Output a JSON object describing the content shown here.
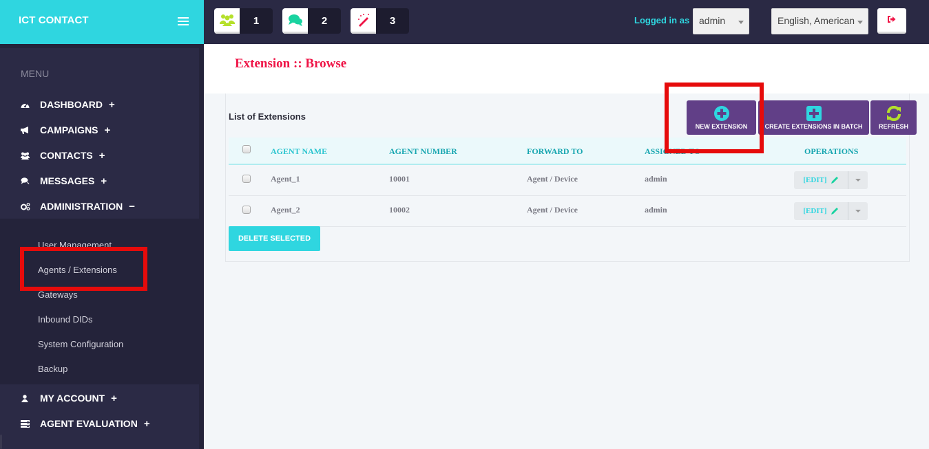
{
  "app": {
    "title": "ICT CONTACT",
    "menu_toggle_icon": "hamburger-icon"
  },
  "header": {
    "notifications": [
      {
        "icon": "users-icon",
        "count": "1",
        "color": "#b5e02b"
      },
      {
        "icon": "chat-bubbles-icon",
        "count": "2",
        "color": "#19d3a0"
      },
      {
        "icon": "magic-wand-icon",
        "count": "3",
        "color": "#ef1547"
      }
    ],
    "logged_in_label": "Logged in as :",
    "user_select_value": "admin",
    "language_select_value": "English, American",
    "logout_icon": "sign-out-icon"
  },
  "sidebar": {
    "menu_label": "MENU",
    "items": [
      {
        "label": "DASHBOARD",
        "icon": "dashboard-icon",
        "toggle": "+"
      },
      {
        "label": "CAMPAIGNS",
        "icon": "bullhorn-icon",
        "toggle": "+"
      },
      {
        "label": "CONTACTS",
        "icon": "users-icon",
        "toggle": "+"
      },
      {
        "label": "MESSAGES",
        "icon": "comments-icon",
        "toggle": "+"
      },
      {
        "label": "ADMINISTRATION",
        "icon": "cogs-icon",
        "toggle": "−"
      },
      {
        "label": "MY ACCOUNT",
        "icon": "user-icon",
        "toggle": "+"
      },
      {
        "label": "AGENT EVALUATION",
        "icon": "tasks-icon",
        "toggle": "+"
      }
    ],
    "admin_subitems": [
      "User Management",
      "Agents / Extensions",
      "Gateways",
      "Inbound DIDs",
      "System Configuration",
      "Backup"
    ],
    "active_subitem": "Agents / Extensions"
  },
  "page": {
    "title": "Extension :: Browse",
    "list_title": "List of Extensions",
    "actions": [
      {
        "label": "NEW EXTENSION",
        "icon": "plus-circle-icon"
      },
      {
        "label": "CREATE EXTENSIONS IN BATCH",
        "icon": "plus-square-icon"
      },
      {
        "label": "REFRESH",
        "icon": "refresh-icon"
      }
    ],
    "table": {
      "columns": [
        "AGENT NAME",
        "AGENT NUMBER",
        "FORWARD TO",
        "ASSIGNED TO",
        "OPERATIONS"
      ],
      "rows": [
        {
          "agent_name": "Agent_1",
          "agent_number": "10001",
          "forward_to": "Agent / Device",
          "assigned_to": "admin",
          "operation": "[EDIT]"
        },
        {
          "agent_name": "Agent_2",
          "agent_number": "10002",
          "forward_to": "Agent / Device",
          "assigned_to": "admin",
          "operation": "[EDIT]"
        }
      ]
    },
    "delete_selected_label": "DELETE SELECTED"
  },
  "colors": {
    "brand": "#2fd6e0",
    "topbar": "#2a2944",
    "sidebar": "#2b2a45",
    "action_button": "#613f87",
    "title_red": "#ef1547",
    "highlight": "#e60b0b"
  }
}
